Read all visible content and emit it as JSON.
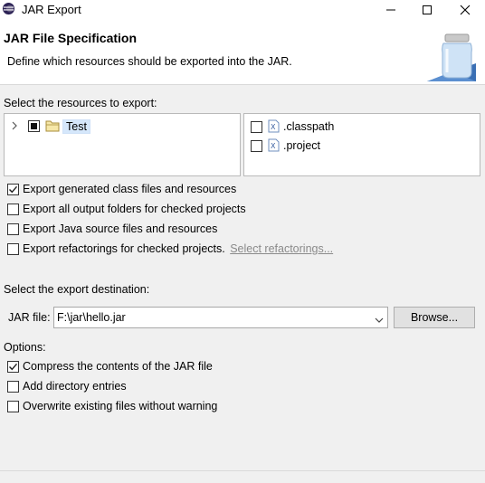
{
  "window": {
    "title": "JAR Export",
    "icon": "eclipse-icon",
    "controls": [
      "minimize-icon",
      "maximize-icon",
      "close-icon"
    ]
  },
  "header": {
    "title": "JAR File Specification",
    "description": "Define which resources should be exported into the JAR."
  },
  "resources": {
    "label": "Select the resources to export:",
    "tree": [
      {
        "label": "Test",
        "state": "partial",
        "expanded": false
      }
    ],
    "files": [
      {
        "label": ".classpath",
        "checked": false
      },
      {
        "label": ".project",
        "checked": false
      }
    ]
  },
  "export_options": [
    {
      "label": "Export generated class files and resources",
      "checked": true
    },
    {
      "label": "Export all output folders for checked projects",
      "checked": false
    },
    {
      "label": "Export Java source files and resources",
      "checked": false
    },
    {
      "label": "Export refactorings for checked projects.",
      "checked": false,
      "link": "Select refactorings..."
    }
  ],
  "destination": {
    "label": "Select the export destination:",
    "jar_file_label": "JAR file:",
    "jar_file_value": "F:\\jar\\hello.jar",
    "browse_label": "Browse..."
  },
  "options": {
    "label": "Options:",
    "items": [
      {
        "label": "Compress the contents of the JAR file",
        "checked": true
      },
      {
        "label": "Add directory entries",
        "checked": false
      },
      {
        "label": "Overwrite existing files without warning",
        "checked": false
      }
    ]
  }
}
